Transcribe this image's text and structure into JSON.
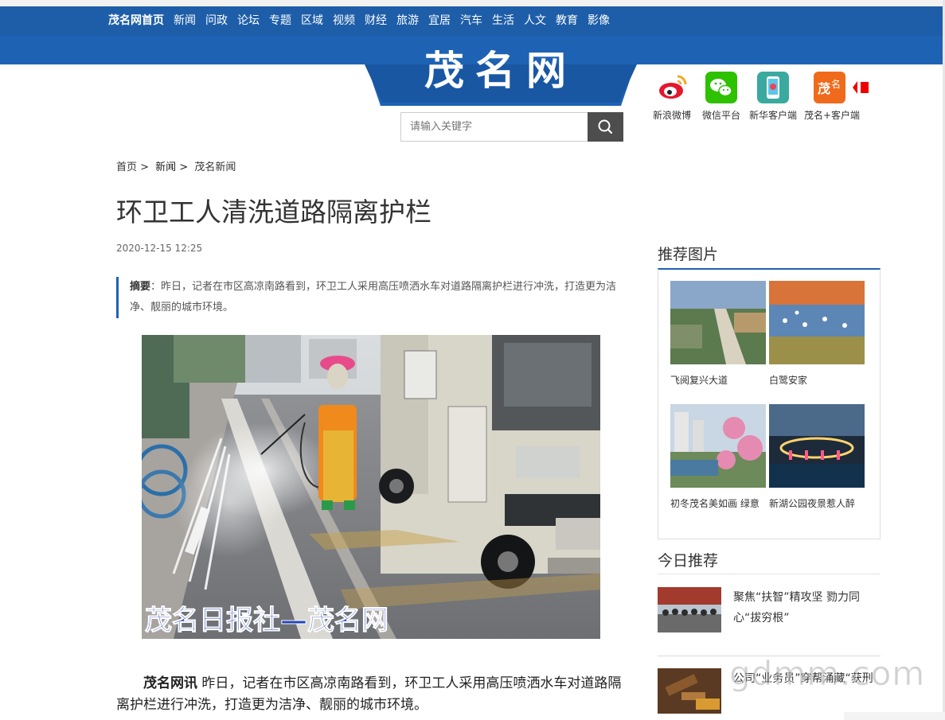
{
  "nav": {
    "items": [
      "茂名网首页",
      "新闻",
      "问政",
      "论坛",
      "专题",
      "区域",
      "视频",
      "财经",
      "旅游",
      "宜居",
      "汽车",
      "生活",
      "人文",
      "教育",
      "影像"
    ]
  },
  "logo": {
    "text": "茂名网"
  },
  "search": {
    "placeholder": "请输入关键字"
  },
  "apps": [
    {
      "label": "新浪微博",
      "icon": "weibo-icon",
      "color": "#e6162d"
    },
    {
      "label": "微信平台",
      "icon": "wechat-icon",
      "color": "#2dc100"
    },
    {
      "label": "新华客户端",
      "icon": "xinhua-app-icon",
      "color": "#3aa9a0"
    },
    {
      "label": "茂名+客户端",
      "icon": "maoming-plus-icon",
      "color": "#f06a1b"
    }
  ],
  "breadcrumb": [
    "首页 >",
    "新闻 >",
    "茂名新闻"
  ],
  "article": {
    "title": "环卫工人清洗道路隔离护栏",
    "date": "2020-12-15 12:25",
    "summary_label": "摘要",
    "summary_text": "：昨日，记者在市区高凉南路看到，环卫工人采用高压喷洒水车对道路隔离护栏进行冲洗，打造更为洁净、靓丽的城市环境。",
    "photo_watermark": "茂名日报社—茂名网",
    "lead_source": "茂名网讯",
    "body": "  昨日，记者在市区高凉南路看到，环卫工人采用高压喷洒水车对道路隔离护栏进行冲洗，打造更为洁净、靓丽的城市环境。"
  },
  "sidebar": {
    "recommended_title": "推荐图片",
    "recommended": [
      {
        "caption": "飞阅复兴大道"
      },
      {
        "caption": "白鹭安家"
      },
      {
        "caption": "初冬茂名美如画 绿意"
      },
      {
        "caption": "新湖公园夜景惹人醉"
      }
    ],
    "today_title": "今日推荐",
    "today": [
      {
        "text": "聚焦“扶智”精攻坚 勠力同心“拔穷根”"
      },
      {
        "text": "公司“业务员”穿帮涌藏“获刑"
      }
    ]
  },
  "watermark": "gdmm.com"
}
